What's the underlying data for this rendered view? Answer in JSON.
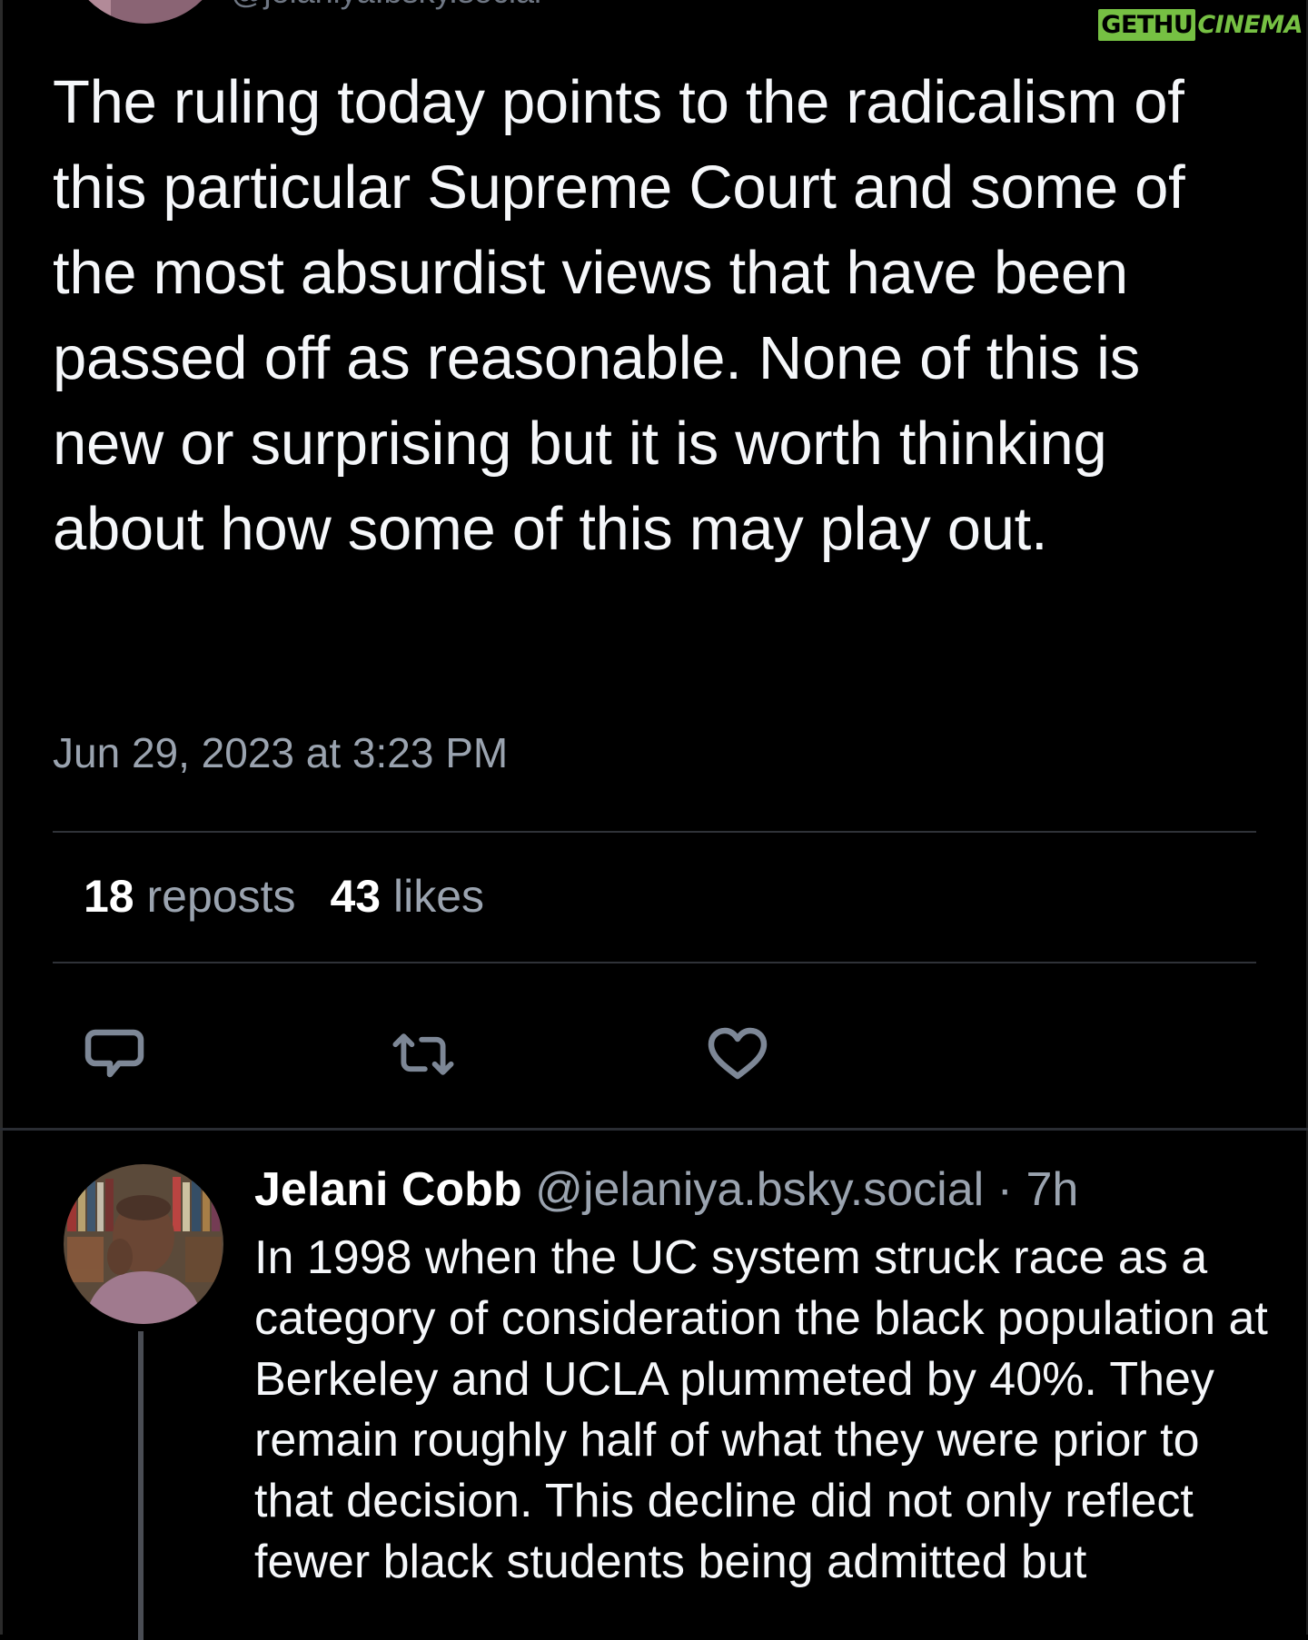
{
  "top_post": {
    "handle": "@jelaniya.bsky.social",
    "text": "The ruling today points to the radicalism of this particular Supreme Court and some of the most absurdist views that have been passed off as reasonable. None of this is new or surprising but it is worth thinking about how some of this may play out.",
    "timestamp": "Jun 29, 2023 at 3:23 PM",
    "stats": {
      "reposts_count": "18",
      "reposts_label": "reposts",
      "likes_count": "43",
      "likes_label": "likes"
    }
  },
  "watermark": {
    "part_a": "GETHU",
    "part_b": "CINEMA"
  },
  "icons": {
    "reply": "reply-icon",
    "repost": "repost-icon",
    "like": "heart-icon"
  },
  "reply_post": {
    "author_name": "Jelani Cobb",
    "handle": "@jelaniya.bsky.social",
    "separator": "·",
    "time": "7h",
    "text": "In 1998 when the UC system struck race as a category of consideration the black population at Berkeley and UCLA plummeted by 40%. They remain roughly half of what they were prior to that decision. This decline did not only reflect fewer black students being admitted but"
  },
  "colors": {
    "background": "#000000",
    "text": "#f5f7fa",
    "muted": "#9aa3af",
    "icon": "#7d8796",
    "watermark_green": "#76c043"
  }
}
